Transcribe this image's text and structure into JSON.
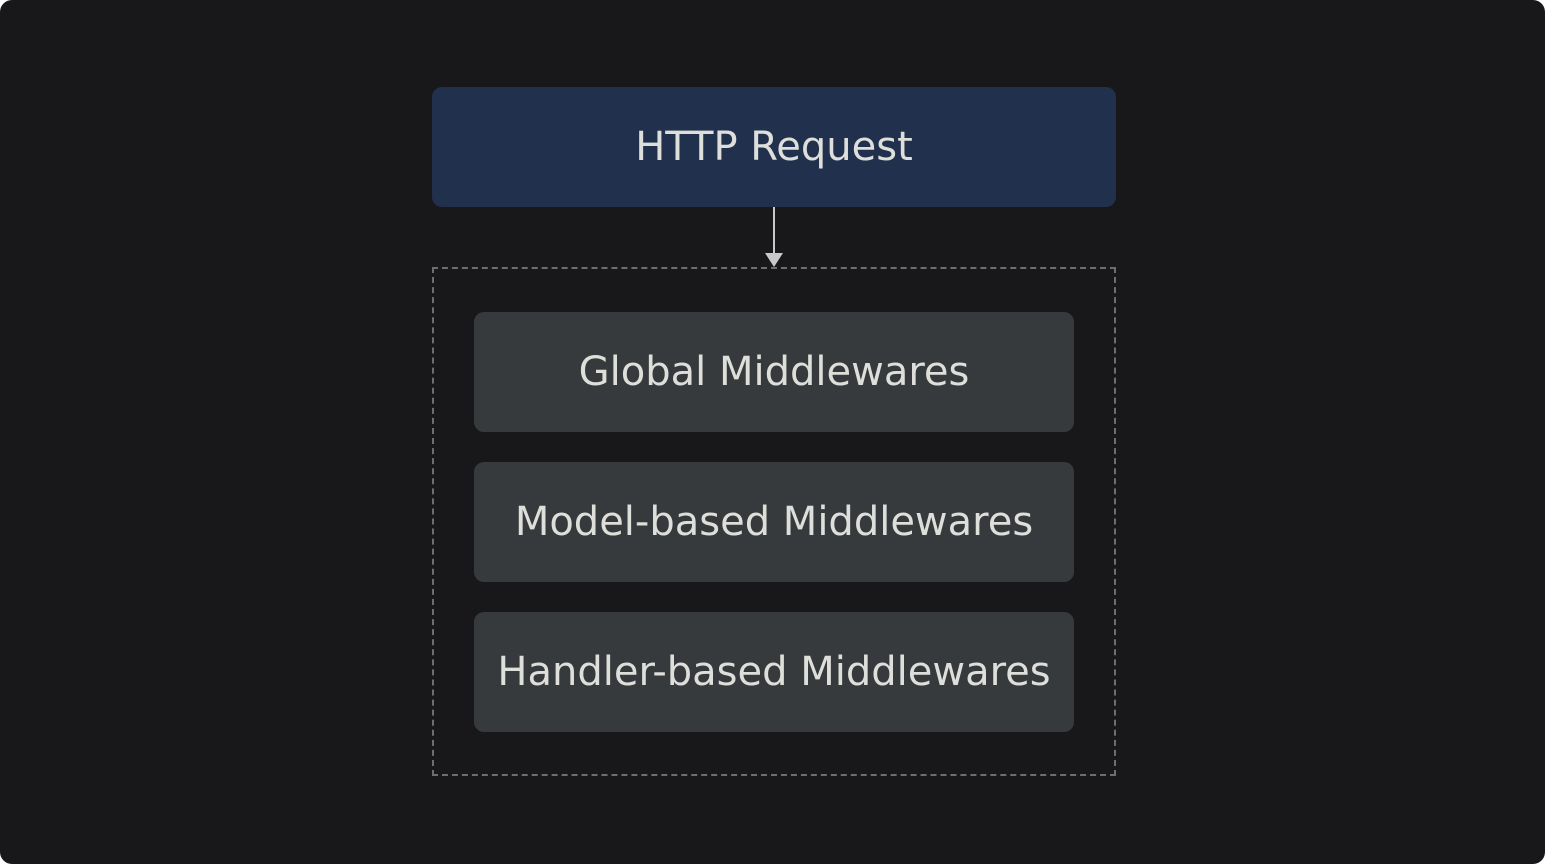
{
  "diagram": {
    "request": {
      "label": "HTTP Request"
    },
    "middlewares": [
      {
        "label": "Global Middlewares"
      },
      {
        "label": "Model-based Middlewares"
      },
      {
        "label": "Handler-based Middlewares"
      }
    ]
  },
  "colors": {
    "background": "#18181b",
    "request_fill": "#21304d",
    "middleware_fill": "#373a3c",
    "text": "#dededa",
    "connector": "#c8c8c8",
    "group_border": "#6d6e70"
  }
}
